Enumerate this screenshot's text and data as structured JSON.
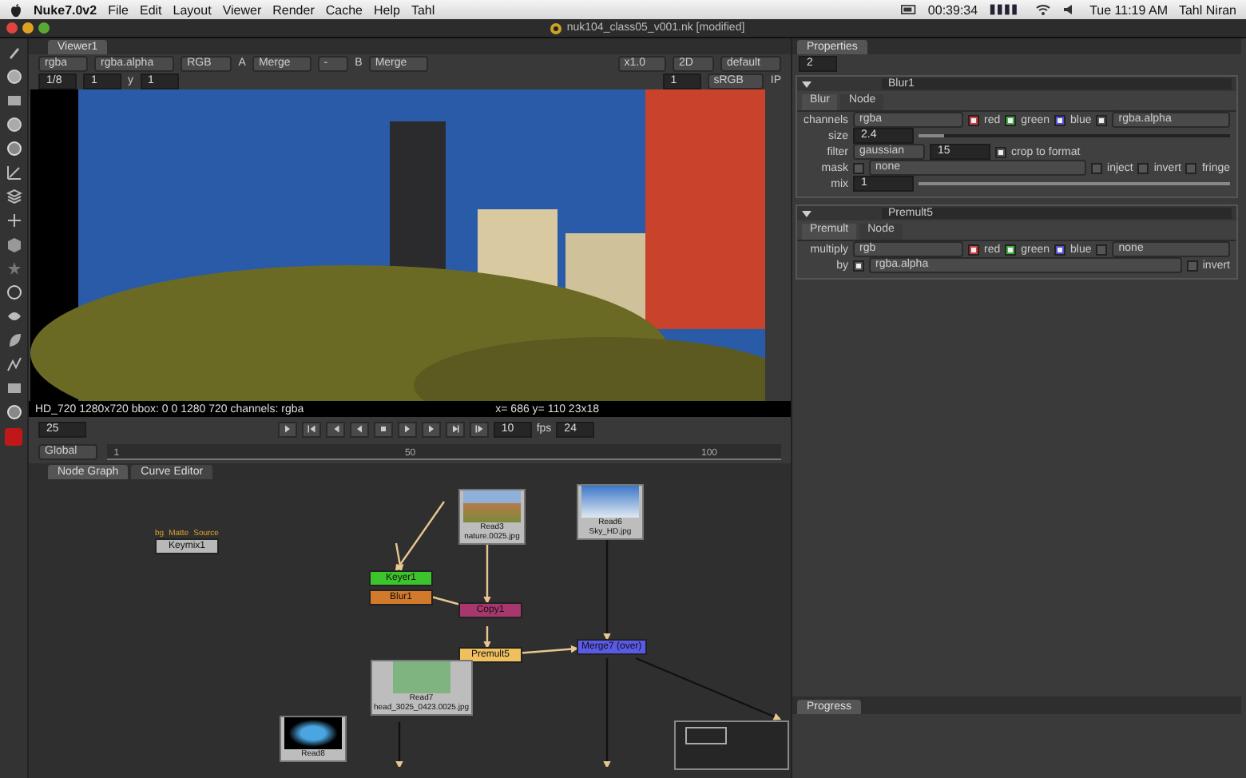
{
  "menubar": {
    "app": "Nuke7.0v2",
    "menus": [
      "File",
      "Edit",
      "Layout",
      "Viewer",
      "Render",
      "Cache",
      "Help",
      "Tahl"
    ],
    "timer": "00:39:34",
    "clock": "Tue 11:19 AM",
    "user": "Tahl Niran"
  },
  "window": {
    "title": "nuk104_class05_v001.nk [modified]"
  },
  "viewer": {
    "tab": "Viewer1",
    "row1": [
      {
        "kind": "dropdown",
        "value": "rgba"
      },
      {
        "kind": "dropdown",
        "value": "rgba.alpha"
      },
      {
        "kind": "dropdown",
        "value": "RGB"
      },
      {
        "kind": "label",
        "value": "A"
      },
      {
        "kind": "dropdown",
        "value": "Merge"
      },
      {
        "kind": "dropdown",
        "value": "-"
      },
      {
        "kind": "label",
        "value": "B"
      },
      {
        "kind": "dropdown",
        "value": "Merge"
      },
      {
        "kind": "gap"
      },
      {
        "kind": "dropdown",
        "value": "x1.0"
      },
      {
        "kind": "dropdown",
        "value": "2D"
      },
      {
        "kind": "dropdown",
        "value": "default"
      }
    ],
    "row2": [
      {
        "kind": "field",
        "value": "1/8"
      },
      {
        "kind": "field",
        "value": "1"
      },
      {
        "kind": "label",
        "value": "y"
      },
      {
        "kind": "field",
        "value": "1"
      },
      {
        "kind": "gap"
      },
      {
        "kind": "field",
        "value": "1"
      },
      {
        "kind": "dropdown",
        "value": "sRGB"
      },
      {
        "kind": "label",
        "value": "IP"
      }
    ],
    "info": "HD_720  1280x720 bbox: 0 0 1280 720 channels: rgba",
    "coords": "x= 686 y= 110   23x18",
    "frame": "25",
    "increment": "10",
    "fps_label": "fps",
    "fps": "24",
    "range": "Global",
    "ruler": [
      "1",
      "50",
      "100"
    ]
  },
  "graph_tabs": [
    {
      "label": "Node Graph",
      "selected": true
    },
    {
      "label": "Curve Editor",
      "selected": false
    }
  ],
  "nodes": [
    {
      "kind": "op",
      "name": "Keymix1",
      "color": "#b8b8b8",
      "inputs": [
        "bg",
        "Matte",
        "Source"
      ]
    },
    {
      "kind": "read",
      "name": "Read3",
      "file": "nature.0025.jpg"
    },
    {
      "kind": "read",
      "name": "Read6",
      "file": "Sky_HD.jpg"
    },
    {
      "kind": "op",
      "name": "Keyer1",
      "color": "#3cc42c"
    },
    {
      "kind": "op",
      "name": "Blur1",
      "color": "#d27a2c"
    },
    {
      "kind": "op",
      "name": "Copy1",
      "color": "#a8376e"
    },
    {
      "kind": "op",
      "name": "Premult5",
      "color": "#f0c060"
    },
    {
      "kind": "op",
      "name": "Merge7 (over)",
      "color": "#5a5ae8"
    },
    {
      "kind": "read",
      "name": "Read7",
      "file": "head_3025_0423.0025.jpg"
    },
    {
      "kind": "read",
      "name": "Read8"
    }
  ],
  "properties": {
    "title": "Properties",
    "count": "2",
    "panels": [
      {
        "name": "Blur1",
        "tabs": [
          {
            "label": "Blur",
            "selected": true
          },
          {
            "label": "Node",
            "selected": false
          }
        ],
        "rows": [
          {
            "kind": "channels",
            "label": "channels",
            "value": "rgba",
            "checks": [
              {
                "label": "red",
                "checked": true,
                "color": "#d04040"
              },
              {
                "label": "green",
                "checked": true,
                "color": "#40b040"
              },
              {
                "label": "blue",
                "checked": true,
                "color": "#5050d0"
              }
            ],
            "extra_checked": true,
            "extra": "rgba.alpha"
          },
          {
            "kind": "slider",
            "label": "size",
            "value": "2.4",
            "level": 0.08
          },
          {
            "kind": "filter",
            "label": "filter",
            "value": "gaussian",
            "quality": "15",
            "check": {
              "label": "crop to format",
              "checked": true
            }
          },
          {
            "kind": "mask",
            "label": "mask",
            "checked": false,
            "value": "none",
            "checks": [
              {
                "label": "inject",
                "checked": false
              },
              {
                "label": "invert",
                "checked": false
              },
              {
                "label": "fringe",
                "checked": false
              }
            ]
          },
          {
            "kind": "slider",
            "label": "mix",
            "value": "1",
            "level": 1
          }
        ]
      },
      {
        "name": "Premult5",
        "tabs": [
          {
            "label": "Premult",
            "selected": true
          },
          {
            "label": "Node",
            "selected": false
          }
        ],
        "rows": [
          {
            "kind": "channels",
            "label": "multiply",
            "value": "rgb",
            "checks": [
              {
                "label": "red",
                "checked": true,
                "color": "#d04040"
              },
              {
                "label": "green",
                "checked": true,
                "color": "#40b040"
              },
              {
                "label": "blue",
                "checked": true,
                "color": "#5050d0"
              }
            ],
            "extra_checked": false,
            "extra": "none"
          },
          {
            "kind": "mask",
            "label": "by",
            "checked": true,
            "value": "rgba.alpha",
            "checks": [
              {
                "label": "invert",
                "checked": false
              }
            ]
          }
        ]
      }
    ]
  },
  "progress_tab": "Progress"
}
